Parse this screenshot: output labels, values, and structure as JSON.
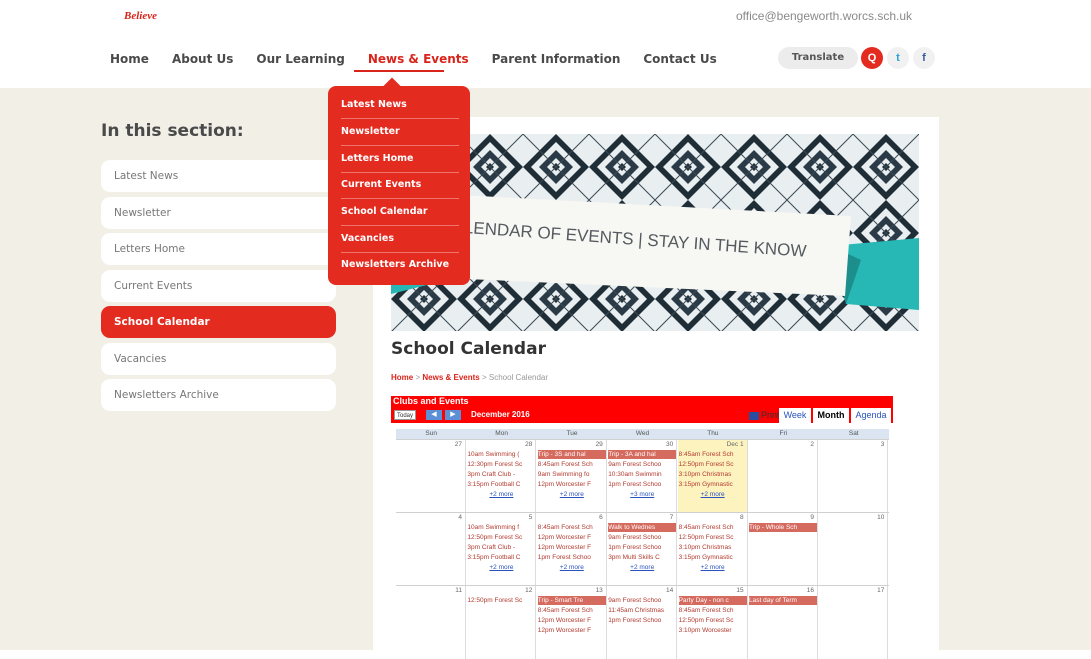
{
  "header": {
    "logo_text": "Believe",
    "email": "office@bengeworth.worcs.sch.uk",
    "nav": [
      {
        "label": "Home"
      },
      {
        "label": "About Us"
      },
      {
        "label": "Our Learning"
      },
      {
        "label": "News & Events"
      },
      {
        "label": "Parent Information"
      },
      {
        "label": "Contact Us"
      }
    ],
    "translate_label": "Translate",
    "search_icon_glyph": "Q",
    "twitter_icon_glyph": "t",
    "facebook_icon_glyph": "f"
  },
  "dropdown": {
    "items": [
      {
        "label": "Latest News"
      },
      {
        "label": "Newsletter"
      },
      {
        "label": "Letters Home"
      },
      {
        "label": "Current Events"
      },
      {
        "label": "School Calendar"
      },
      {
        "label": "Vacancies"
      },
      {
        "label": "Newsletters Archive"
      }
    ]
  },
  "sidebar": {
    "title": "In this section:",
    "items": [
      {
        "label": "Latest News"
      },
      {
        "label": "Newsletter"
      },
      {
        "label": "Letters Home"
      },
      {
        "label": "Current Events"
      },
      {
        "label": "School Calendar"
      },
      {
        "label": "Vacancies"
      },
      {
        "label": "Newsletters Archive"
      }
    ]
  },
  "banner": {
    "text": "CALENDAR OF EVENTS | STAY IN THE KNOW"
  },
  "main": {
    "page_title": "School Calendar",
    "breadcrumb": {
      "home": "Home",
      "sep1": ">",
      "section": "News & Events",
      "sep2": ">",
      "current": "School Calendar"
    }
  },
  "calendar": {
    "title": "Clubs and Events",
    "today_label": "Today",
    "prev_glyph": "◀",
    "next_glyph": "▶",
    "month_label": "December 2016",
    "print_label": "Print",
    "views": {
      "week": "Week",
      "month": "Month",
      "agenda": "Agenda"
    },
    "dow": [
      "Sun",
      "Mon",
      "Tue",
      "Wed",
      "Thu",
      "Fri",
      "Sat"
    ],
    "weeks": [
      {
        "days": [
          {
            "num": "27",
            "events": [],
            "more": ""
          },
          {
            "num": "28",
            "events": [
              {
                "text": "10am Swimming (",
                "bar": false
              },
              {
                "text": "12:30pm Forest Sc",
                "bar": false
              },
              {
                "text": "3pm Craft Club - ",
                "bar": false
              },
              {
                "text": "3:15pm Football C",
                "bar": false
              }
            ],
            "more": "+2 more"
          },
          {
            "num": "29",
            "events": [
              {
                "text": "Trip - 3S and hal",
                "bar": true
              },
              {
                "text": "8:45am Forest Sch",
                "bar": false
              },
              {
                "text": "9am Swimming fo",
                "bar": false
              },
              {
                "text": "12pm Worcester F",
                "bar": false
              }
            ],
            "more": "+2 more"
          },
          {
            "num": "30",
            "events": [
              {
                "text": "Trip - 3A and hal",
                "bar": true
              },
              {
                "text": "9am Forest Schoo",
                "bar": false
              },
              {
                "text": "10:30am Swimmin",
                "bar": false
              },
              {
                "text": "1pm Forest Schoo",
                "bar": false
              }
            ],
            "more": "+3 more"
          },
          {
            "num": "Dec 1",
            "events": [
              {
                "text": "8:45am Forest Sch",
                "bar": false
              },
              {
                "text": "12:50pm Forest Sc",
                "bar": false
              },
              {
                "text": "3:10pm Christmas",
                "bar": false
              },
              {
                "text": "3:15pm Gymnastic",
                "bar": false
              }
            ],
            "more": "+2 more"
          },
          {
            "num": "2",
            "events": [],
            "more": ""
          },
          {
            "num": "3",
            "events": [],
            "more": ""
          }
        ]
      },
      {
        "days": [
          {
            "num": "4",
            "events": [],
            "more": ""
          },
          {
            "num": "5",
            "events": [
              {
                "text": "10am Swimming f",
                "bar": false
              },
              {
                "text": "12:50pm Forest Sc",
                "bar": false
              },
              {
                "text": "3pm Craft Club - ",
                "bar": false
              },
              {
                "text": "3:15pm Football C",
                "bar": false
              }
            ],
            "more": "+2 more"
          },
          {
            "num": "6",
            "events": [
              {
                "text": "8:45am Forest Sch",
                "bar": false
              },
              {
                "text": "12pm Worcester F",
                "bar": false
              },
              {
                "text": "12pm Worcester F",
                "bar": false
              },
              {
                "text": "1pm Forest Schoo",
                "bar": false
              }
            ],
            "more": "+2 more"
          },
          {
            "num": "7",
            "events": [
              {
                "text": "Walk to Wednes",
                "bar": true
              },
              {
                "text": "9am Forest Schoo",
                "bar": false
              },
              {
                "text": "1pm Forest Schoo",
                "bar": false
              },
              {
                "text": "3pm Multi Skills C",
                "bar": false
              }
            ],
            "more": "+2 more"
          },
          {
            "num": "8",
            "events": [
              {
                "text": "8:45am Forest Sch",
                "bar": false
              },
              {
                "text": "12:50pm Forest Sc",
                "bar": false
              },
              {
                "text": "3:10pm Christmas",
                "bar": false
              },
              {
                "text": "3:15pm Gymnastic",
                "bar": false
              }
            ],
            "more": "+2 more"
          },
          {
            "num": "9",
            "events": [
              {
                "text": "Trip - Whole Sch",
                "bar": true
              }
            ],
            "more": ""
          },
          {
            "num": "10",
            "events": [],
            "more": ""
          }
        ]
      },
      {
        "days": [
          {
            "num": "11",
            "events": [],
            "more": ""
          },
          {
            "num": "12",
            "events": [
              {
                "text": "12:50pm Forest Sc",
                "bar": false
              }
            ],
            "more": ""
          },
          {
            "num": "13",
            "events": [
              {
                "text": "Trip - Smart Tre",
                "bar": true
              },
              {
                "text": "8:45am Forest Sch",
                "bar": false
              },
              {
                "text": "12pm Worcester F",
                "bar": false
              },
              {
                "text": "12pm Worcester F",
                "bar": false
              }
            ],
            "more": ""
          },
          {
            "num": "14",
            "events": [
              {
                "text": "9am Forest Schoo",
                "bar": false
              },
              {
                "text": "11:45am Christmas",
                "bar": false
              },
              {
                "text": "1pm Forest Schoo",
                "bar": false
              }
            ],
            "more": ""
          },
          {
            "num": "15",
            "events": [
              {
                "text": "Party Day - non c",
                "bar": true
              },
              {
                "text": "8:45am Forest Sch",
                "bar": false
              },
              {
                "text": "12:50pm Forest Sc",
                "bar": false
              },
              {
                "text": "3:10pm Worcester",
                "bar": false
              }
            ],
            "more": ""
          },
          {
            "num": "16",
            "events": [
              {
                "text": "Last day of Term",
                "bar": true
              }
            ],
            "more": ""
          },
          {
            "num": "17",
            "events": [],
            "more": ""
          }
        ]
      }
    ]
  }
}
